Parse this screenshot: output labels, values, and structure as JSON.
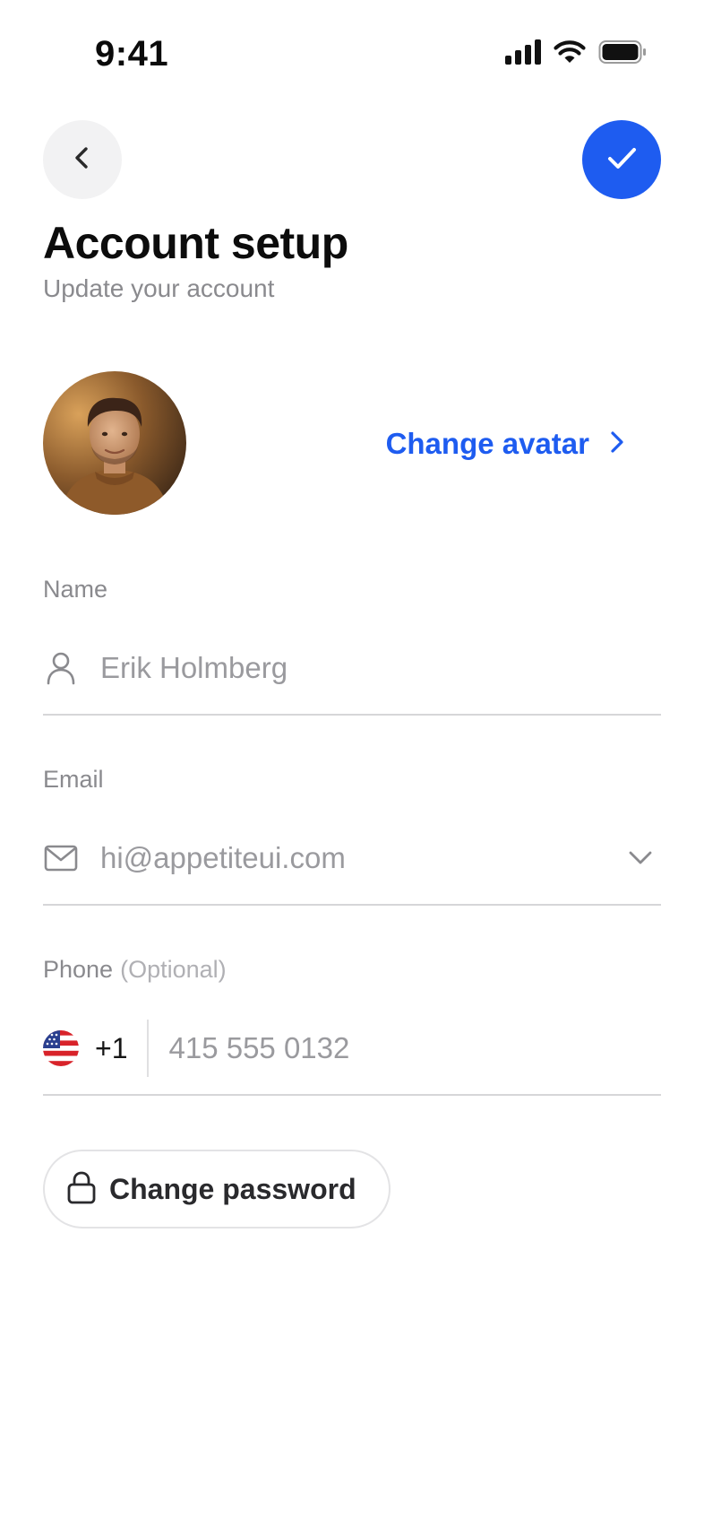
{
  "status_bar": {
    "time": "9:41",
    "icons": [
      "cellular-signal-icon",
      "wifi-icon",
      "battery-icon"
    ]
  },
  "nav": {
    "back_icon": "chevron-left-icon",
    "confirm_icon": "checkmark-icon"
  },
  "header": {
    "title": "Account setup",
    "subtitle": "Update your account"
  },
  "avatar": {
    "change_label": "Change avatar",
    "icon": "chevron-right-icon"
  },
  "form": {
    "name": {
      "label": "Name",
      "value": "Erik Holmberg",
      "icon": "user-icon"
    },
    "email": {
      "label": "Email",
      "value": "hi@appetiteui.com",
      "icon": "mail-icon",
      "chevron_icon": "chevron-down-icon"
    },
    "phone": {
      "label": "Phone",
      "optional_label": "(Optional)",
      "country_flag": "us-flag-icon",
      "dial_code": "+1",
      "value": "415 555 0132"
    }
  },
  "actions": {
    "change_password_label": "Change password",
    "lock_icon": "lock-icon"
  },
  "colors": {
    "accent": "#1E5CF0",
    "text_primary": "#0C0C0C",
    "text_secondary": "#8A8A8E",
    "divider": "#D6D6D8",
    "back_button_bg": "#F2F2F3"
  }
}
